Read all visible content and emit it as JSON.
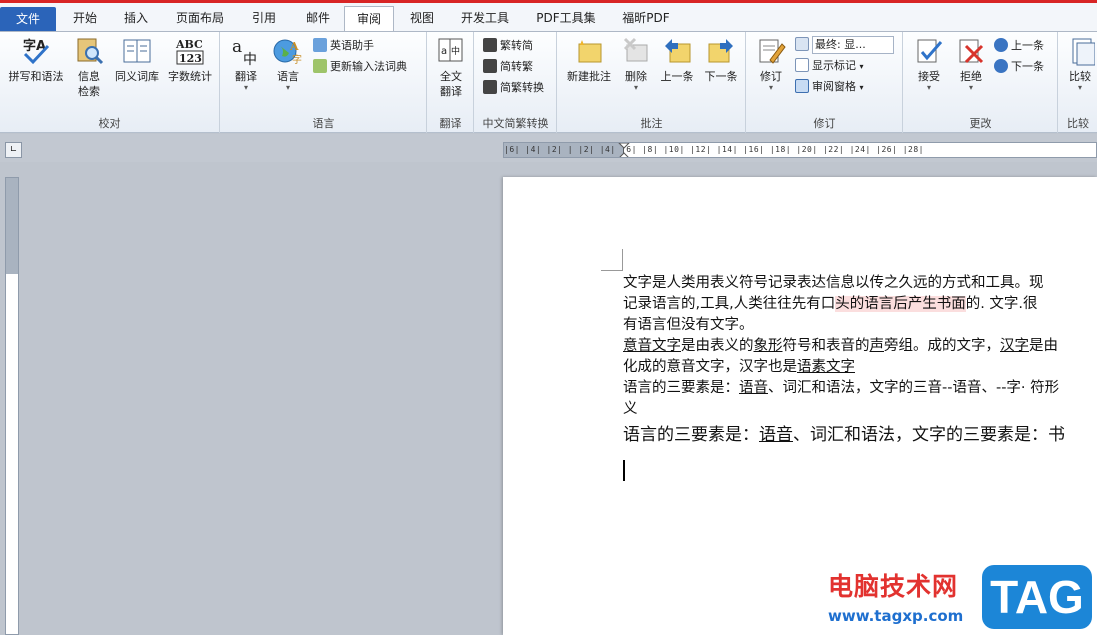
{
  "tabs": [
    {
      "label": "文件"
    },
    {
      "label": "开始"
    },
    {
      "label": "插入"
    },
    {
      "label": "页面布局"
    },
    {
      "label": "引用"
    },
    {
      "label": "邮件"
    },
    {
      "label": "审阅"
    },
    {
      "label": "视图"
    },
    {
      "label": "开发工具"
    },
    {
      "label": "PDF工具集"
    },
    {
      "label": "福昕PDF"
    }
  ],
  "active_tab": "审阅",
  "ribbon": {
    "proofing": {
      "label": "校对",
      "spelling": "拼写和语法",
      "research_1": "信息",
      "research_2": "检索",
      "thesaurus": "同义词库",
      "word_count": "字数统计"
    },
    "language": {
      "label": "语言",
      "translate": "翻译",
      "language": "语言",
      "english_assistant": "英语助手",
      "update_ime": "更新输入法词典"
    },
    "translation": {
      "label": "翻译",
      "full_1": "全文",
      "full_2": "翻译"
    },
    "chinese": {
      "label": "中文简繁转换",
      "t2s": "繁转简",
      "s2t": "简转繁",
      "convert": "简繁转换"
    },
    "comments": {
      "label": "批注",
      "new": "新建批注",
      "delete": "删除",
      "prev": "上一条",
      "next": "下一条"
    },
    "tracking": {
      "label": "修订",
      "track": "修订",
      "display_value": "最终: 显...",
      "show_markup": "显示标记",
      "review_pane": "审阅窗格"
    },
    "changes": {
      "label": "更改",
      "accept": "接受",
      "reject": "拒绝",
      "prev": "上一条",
      "next": "下一条"
    },
    "compare": {
      "label": "比较",
      "compare": "比较"
    }
  },
  "ruler": {
    "horizontal_ticks": "|6| |4| |2| |  |2| |4| |6| |8| |10| |12| |14| |16| |18| |20| |22| |24| |26| |28|"
  },
  "document": {
    "line1": "文字是人类用表义符号记录表达信息以传之久远的方式和工具。现",
    "line2a": "记录语言的,工具,人类往往先有口",
    "line2b": "头的语言后产生书面",
    "line2c": "的. 文字.很",
    "line3": "有语言但没有文字。",
    "line4a": "意音文字",
    "line4b": "是由表义的",
    "line4c": "象形",
    "line4d": "符号和表音的",
    "line4e": "声",
    "line4f": "旁组。成的文字，",
    "line4g": "汉字",
    "line4h": "是由",
    "line5a": "化成的意音文字，汉字也是",
    "line5b": "语素文字",
    "line6a": "语言的三要素是：",
    "line6b": "语音",
    "line6c": "、词汇和语法，文字的三音--语音、--字· 符形",
    "line7": "义",
    "line8a": "语言的三要素是：",
    "line8b": "语音",
    "line8c": "、词汇和语法，文字的三要素是：书"
  },
  "watermark": {
    "site_name": "电脑技术网",
    "url": "www.tagxp.com",
    "badge": "TAG"
  }
}
